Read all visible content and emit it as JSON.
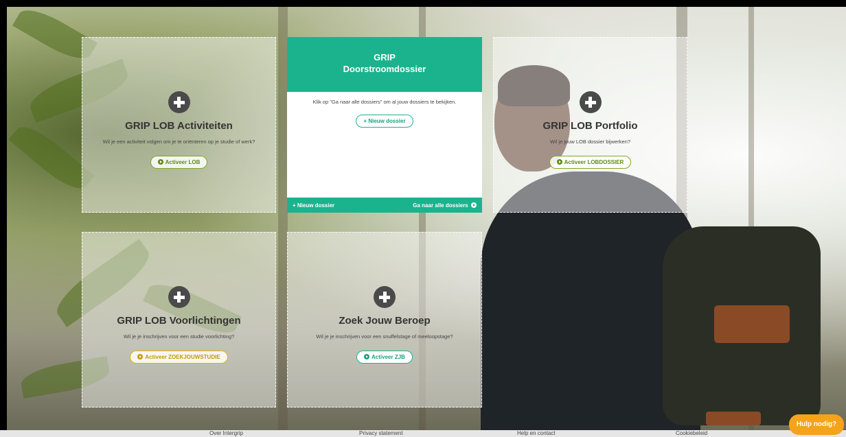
{
  "cards": {
    "activiteiten": {
      "title": "GRIP LOB Activiteiten",
      "subtitle": "Wil je een activiteit volgen om je te oriënteren op je studie of werk?",
      "button": "Activeer LOB"
    },
    "portfolio": {
      "title": "GRIP LOB Portfolio",
      "subtitle": "Wil je jouw LOB dossier bijwerken?",
      "button": "Activeer LOBDOSSIER"
    },
    "voorlichtingen": {
      "title": "GRIP LOB Voorlichtingen",
      "subtitle": "Wil je je inschrijven voor een studie voorlichting?",
      "button": "Activeer ZOEKJOUWSTUDIE"
    },
    "beroep": {
      "title": "Zoek Jouw Beroep",
      "subtitle": "Wil je je inschrijven voor een snuffelstage of meeloopstage?",
      "button": "Activeer ZJB"
    }
  },
  "doorstroom": {
    "title_line1": "GRIP",
    "title_line2": "Doorstroomdossier",
    "hint": "Klik op \"Ga naar alle dossiers\" om al jouw dossiers te bekijken.",
    "new_button": "+ Nieuw dossier",
    "footer_left": "+ Nieuw dossier",
    "footer_right": "Ga naar alle dossiers"
  },
  "footer": {
    "links": [
      "Over Intergrip",
      "Privacy statement",
      "Help en contact",
      "Cookiebeleid"
    ]
  },
  "help_button": "Hulp nodig?",
  "colors": {
    "teal": "#1bb38d",
    "green": "#7da825",
    "yellow": "#e0b400",
    "orange": "#f5a31a"
  }
}
